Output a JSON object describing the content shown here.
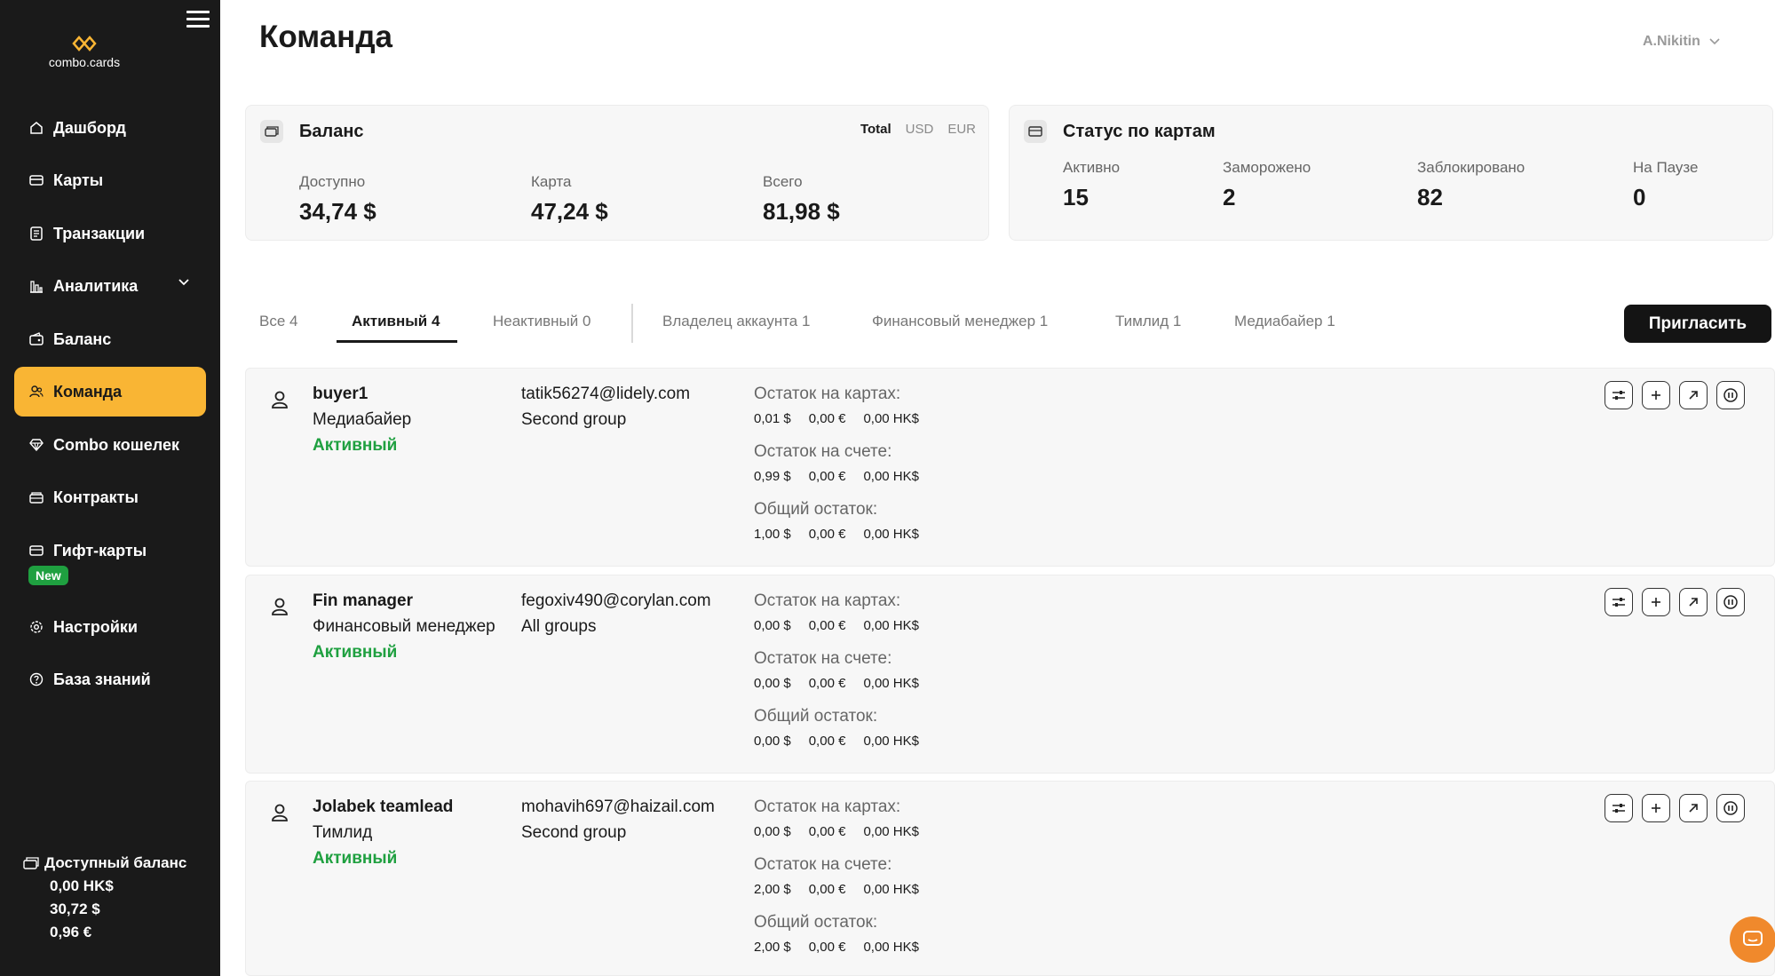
{
  "sidebar": {
    "logo_text": "combo.cards",
    "items": [
      {
        "label": "Дашборд",
        "icon": "home-icon"
      },
      {
        "label": "Карты",
        "icon": "card-icon"
      },
      {
        "label": "Транзакции",
        "icon": "document-icon"
      },
      {
        "label": "Аналитика",
        "icon": "chart-icon"
      },
      {
        "label": "Баланс",
        "icon": "wallet-icon"
      },
      {
        "label": "Команда",
        "icon": "team-icon",
        "active": true
      },
      {
        "label": "Combo кошелек",
        "icon": "diamond-icon"
      },
      {
        "label": "Контракты",
        "icon": "folder-icon"
      },
      {
        "label": "Гифт-карты",
        "icon": "gift-card-icon"
      },
      {
        "label": "Настройки",
        "icon": "gear-icon"
      },
      {
        "label": "База знаний",
        "icon": "help-icon"
      }
    ],
    "new_badge": "New",
    "available_balance": {
      "title": "Доступный баланс",
      "lines": [
        "0,00 HK$",
        "30,72 $",
        "0,96 €"
      ]
    }
  },
  "header": {
    "title": "Команда",
    "user": "A.Nikitin"
  },
  "balance_card": {
    "title": "Баланс",
    "currency_tabs": [
      "Total",
      "USD",
      "EUR"
    ],
    "selected_currency": "Total",
    "stats": [
      {
        "label": "Доступно",
        "value": "34,74 $"
      },
      {
        "label": "Карта",
        "value": "47,24 $"
      },
      {
        "label": "Всего",
        "value": "81,98 $"
      }
    ]
  },
  "status_card": {
    "title": "Статус по картам",
    "stats": [
      {
        "label": "Активно",
        "value": "15"
      },
      {
        "label": "Заморожено",
        "value": "2"
      },
      {
        "label": "Заблокировано",
        "value": "82"
      },
      {
        "label": "На Паузе",
        "value": "0"
      }
    ]
  },
  "tabs": [
    {
      "label": "Все 4"
    },
    {
      "label": "Активный 4",
      "active": true
    },
    {
      "label": "Неактивный 0"
    },
    {
      "label": "Владелец аккаунта 1"
    },
    {
      "label": "Финансовый менеджер 1"
    },
    {
      "label": "Тимлид 1"
    },
    {
      "label": "Медиабайер 1"
    }
  ],
  "invite_label": "Пригласить",
  "balance_labels": {
    "cards": "Остаток на картах:",
    "account": "Остаток на счете:",
    "total": "Общий остаток:"
  },
  "members": [
    {
      "name": "buyer1",
      "role": "Медиабайер",
      "status": "Активный",
      "email": "tatik56274@lidely.com",
      "group": "Second group",
      "cards": [
        "0,01 $",
        "0,00 €",
        "0,00 HK$"
      ],
      "account": [
        "0,99 $",
        "0,00 €",
        "0,00 HK$"
      ],
      "total": [
        "1,00 $",
        "0,00 €",
        "0,00 HK$"
      ]
    },
    {
      "name": "Fin manager",
      "role": "Финансовый менеджер",
      "status": "Активный",
      "email": "fegoxiv490@corylan.com",
      "group": "All groups",
      "cards": [
        "0,00 $",
        "0,00 €",
        "0,00 HK$"
      ],
      "account": [
        "0,00 $",
        "0,00 €",
        "0,00 HK$"
      ],
      "total": [
        "0,00 $",
        "0,00 €",
        "0,00 HK$"
      ]
    },
    {
      "name": "Jolabek teamlead",
      "role": "Тимлид",
      "status": "Активный",
      "email": "mohavih697@haizail.com",
      "group": "Second group",
      "cards": [
        "0,00 $",
        "0,00 €",
        "0,00 HK$"
      ],
      "account": [
        "2,00 $",
        "0,00 €",
        "0,00 HK$"
      ],
      "total": [
        "2,00 $",
        "0,00 €",
        "0,00 HK$"
      ]
    }
  ],
  "colors": {
    "sidebar_bg": "#1a1a1a",
    "accent": "#f9b534",
    "active_status": "#1fa040",
    "chat": "#f0892c"
  }
}
